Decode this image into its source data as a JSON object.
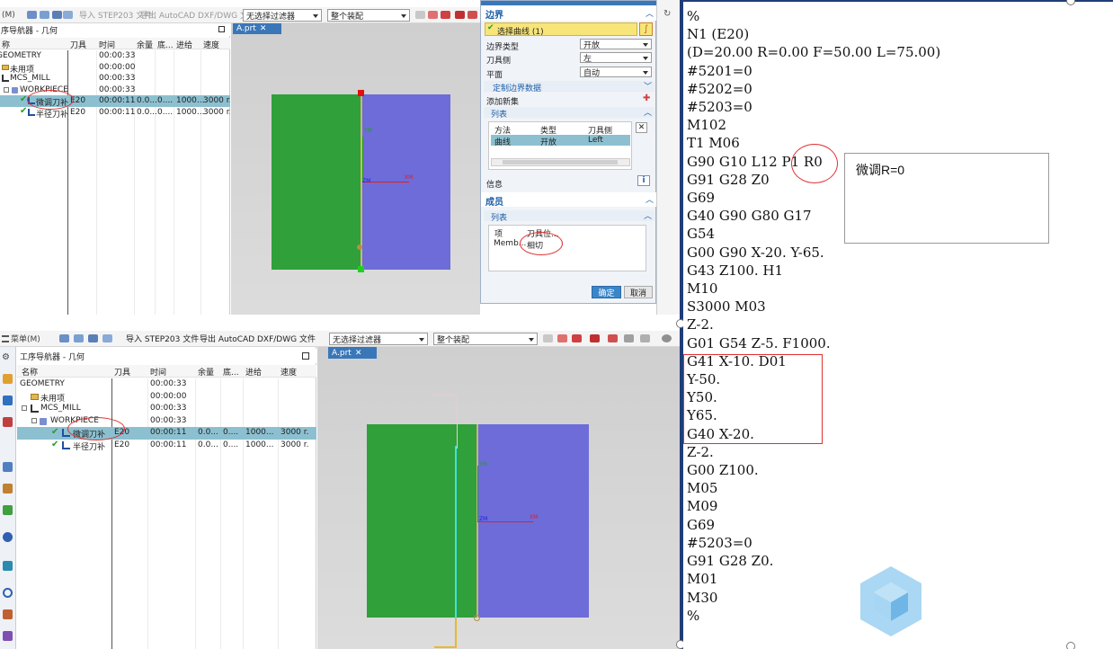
{
  "top": {
    "toolbar": {
      "menu_label": "(M)",
      "import_step": "导入 STEP203 文件",
      "export_dxf": "导出 AutoCAD DXF/DWG 文件",
      "filter_value": "无选择过滤器",
      "assembly_value": "整个装配"
    },
    "navigator": {
      "title": "序导航器 - 几何",
      "columns": [
        "称",
        "刀具",
        "时间",
        "余量",
        "底...",
        "进给",
        "速度"
      ],
      "rows": [
        {
          "name": "GEOMETRY",
          "tool": "",
          "time": "00:00:33",
          "stock": "",
          "floor": "",
          "feed": "",
          "speed": ""
        },
        {
          "name": "未用项",
          "tool": "",
          "time": "00:00:00",
          "stock": "",
          "floor": "",
          "feed": "",
          "speed": ""
        },
        {
          "name": "MCS_MILL",
          "tool": "",
          "time": "00:00:33",
          "stock": "",
          "floor": "",
          "feed": "",
          "speed": ""
        },
        {
          "name": "WORKPIECE",
          "tool": "",
          "time": "00:00:33",
          "stock": "",
          "floor": "",
          "feed": "",
          "speed": ""
        },
        {
          "name": "微调刀补",
          "tool": "E20",
          "time": "00:00:11",
          "stock": "0.0...",
          "floor": "0....",
          "feed": "1000...",
          "speed": "3000 r."
        },
        {
          "name": "半径刀补",
          "tool": "E20",
          "time": "00:00:11",
          "stock": "0.0...",
          "floor": "0....",
          "feed": "1000...",
          "speed": "3000 r."
        }
      ]
    },
    "viewport": {
      "tab_label": "A.prt",
      "axis_zm": "ZM",
      "axis_xm": "XM",
      "axis_ym": "YM"
    },
    "dialog": {
      "title": "边界",
      "select_curve": "选择曲线 (1)",
      "boundary_type_label": "边界类型",
      "boundary_type_value": "开放",
      "tool_side_label": "刀具侧",
      "tool_side_value": "左",
      "plane_label": "平面",
      "plane_value": "自动",
      "custom_boundary": "定制边界数据",
      "add_new_set": "添加新集",
      "list_label": "列表",
      "list_columns": [
        "方法",
        "类型",
        "刀具侧"
      ],
      "list_row": [
        "曲线",
        "开放",
        "Left"
      ],
      "info_label": "信息",
      "members_label": "成员",
      "members_list_label": "列表",
      "members_columns": [
        "项",
        "刀具位..."
      ],
      "members_row": [
        "Memb...",
        "相切"
      ],
      "ok_label": "确定",
      "cancel_label": "取消"
    }
  },
  "bottom": {
    "toolbar": {
      "menu_label": "菜单(M)",
      "import_step": "导入 STEP203 文件",
      "export_dxf": "导出 AutoCAD DXF/DWG 文件",
      "filter_value": "无选择过滤器",
      "assembly_value": "整个装配"
    },
    "navigator": {
      "title": "工序导航器 - 几何",
      "columns": [
        "名称",
        "刀具",
        "时间",
        "余量",
        "底...",
        "进给",
        "速度"
      ],
      "rows": [
        {
          "name": "GEOMETRY",
          "tool": "",
          "time": "00:00:33",
          "stock": "",
          "floor": "",
          "feed": "",
          "speed": ""
        },
        {
          "name": "未用项",
          "tool": "",
          "time": "00:00:00",
          "stock": "",
          "floor": "",
          "feed": "",
          "speed": ""
        },
        {
          "name": "MCS_MILL",
          "tool": "",
          "time": "00:00:33",
          "stock": "",
          "floor": "",
          "feed": "",
          "speed": ""
        },
        {
          "name": "WORKPIECE",
          "tool": "",
          "time": "00:00:33",
          "stock": "",
          "floor": "",
          "feed": "",
          "speed": ""
        },
        {
          "name": "微调刀补",
          "tool": "E20",
          "time": "00:00:11",
          "stock": "0.0...",
          "floor": "0....",
          "feed": "1000...",
          "speed": "3000 r."
        },
        {
          "name": "半径刀补",
          "tool": "E20",
          "time": "00:00:11",
          "stock": "0.0...",
          "floor": "0....",
          "feed": "1000...",
          "speed": "3000 r."
        }
      ]
    },
    "viewport": {
      "tab_label": "A.prt",
      "axis_zm": "ZM",
      "axis_xm": "XM",
      "axis_ym": "YM"
    }
  },
  "code": {
    "lines": [
      "%",
      "N1 (E20)",
      "(D=20.00 R=0.00 F=50.00 L=75.00)",
      "#5201=0",
      "#5202=0",
      "#5203=0",
      "M102",
      "T1 M06",
      "G90 G10 L12 P1 R0",
      "G91 G28 Z0",
      "G69",
      "G40 G90 G80 G17",
      "G54",
      "G00 G90 X-20. Y-65.",
      "G43 Z100. H1",
      "M10",
      "S3000 M03",
      "Z-2.",
      "G01 G54 Z-5. F1000.",
      "G41 X-10. D01",
      "Y-50.",
      "Y50.",
      "Y65.",
      "G40 X-20.",
      "Z-2.",
      "G00 Z100.",
      "M05",
      "M09",
      "G69",
      "#5203=0",
      "G91 G28 Z0.",
      "M01",
      "M30",
      "%"
    ],
    "note": "微调R=0"
  },
  "colors": {
    "accent": "#3a77b8",
    "green_face": "#2fa03a",
    "blue_face": "#6d6cd8",
    "annotation": "#e03030"
  }
}
